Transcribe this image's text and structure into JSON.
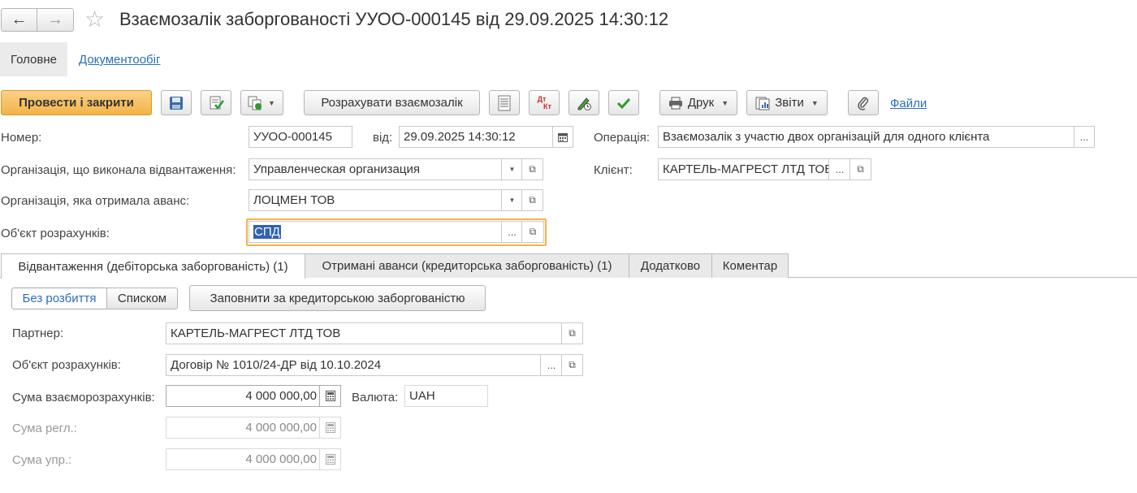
{
  "header": {
    "title": "Взаємозалік заборгованості УУОО-000145 від 29.09.2025 14:30:12",
    "nav": [
      "Головне",
      "Документообіг"
    ]
  },
  "toolbar": {
    "post_close": "Провести і закрити",
    "calc": "Розрахувати взаємозалік",
    "print": "Друк",
    "reports": "Звіти",
    "files": "Файли",
    "dtkt_top": "Дт",
    "dtkt_bottom": "Кт"
  },
  "form": {
    "number_label": "Номер:",
    "number": "УУОО-000145",
    "date_label": "від:",
    "date": "29.09.2025 14:30:12",
    "operation_label": "Операція:",
    "operation": "Взаємозалік з участю двох організацій для одного клієнта",
    "org_ship_label": "Організація, що виконала відвантаження:",
    "org_ship": "Управленческая организация",
    "client_label": "Клієнт:",
    "client": "КАРТЕЛЬ-МАГРЕСТ ЛТД ТОВ",
    "org_adv_label": "Організація, яка отримала аванс:",
    "org_adv": "ЛОЦМЕН ТОВ",
    "settle_label": "Об'єкт розрахунків:",
    "settle": "СПД"
  },
  "tabs": [
    "Відвантаження (дебіторська заборгованість) (1)",
    "Отримані аванси (кредиторська заборгованість) (1)",
    "Додатково",
    "Коментар"
  ],
  "panel": {
    "mode_nosplit": "Без розбиття",
    "mode_list": "Списком",
    "fill_btn": "Заповнити за кредиторською заборгованістю",
    "partner_label": "Партнер:",
    "partner": "КАРТЕЛЬ-МАГРЕСТ ЛТД ТОВ",
    "obj_label": "Об'єкт розрахунків:",
    "obj": "Договір № 1010/24-ДР від 10.10.2024",
    "sum_label": "Сума взаєморозрахунків:",
    "sum": "4 000 000,00",
    "currency_label": "Валюта:",
    "currency": "UAH",
    "sum_reg_label": "Сума регл.:",
    "sum_reg": "4 000 000,00",
    "sum_mgmt_label": "Сума упр.:",
    "sum_mgmt": "4 000 000,00"
  },
  "colors": {
    "accent": "#f2b347",
    "link": "#2a6ec1",
    "selection": "#3261b5"
  },
  "icons": [
    "back-arrow-icon",
    "forward-arrow-icon",
    "star-icon",
    "save-icon",
    "post-icon",
    "create-based-icon",
    "list-icon",
    "dtkt-icon",
    "edit-clock-icon",
    "check-icon",
    "printer-icon",
    "reports-icon",
    "paperclip-icon",
    "calendar-icon",
    "dropdown-icon",
    "open-icon",
    "calculator-icon"
  ]
}
